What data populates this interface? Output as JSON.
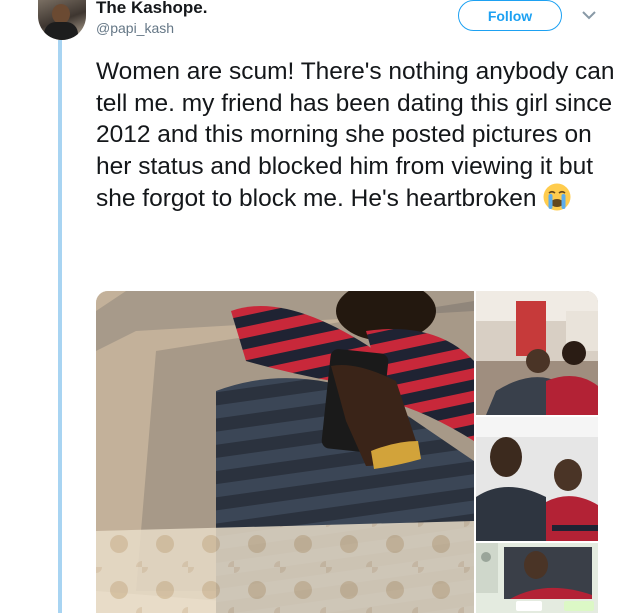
{
  "tweet": {
    "display_name": "The Kashope.",
    "handle": "@papi_kash",
    "follow_label": "Follow",
    "text": "Women are scum! There's nothing anybody can tell me. my friend has been dating this girl since 2012 and this morning she posted pictures on her status and blocked him from viewing it but she forgot to block me. He's heartbroken",
    "emoji": "loudly-crying-face",
    "media_count": 4
  },
  "colors": {
    "accent": "#1da1f2",
    "thread_line": "#a8d4f2",
    "text": "#14171a",
    "secondary_text": "#657786"
  }
}
